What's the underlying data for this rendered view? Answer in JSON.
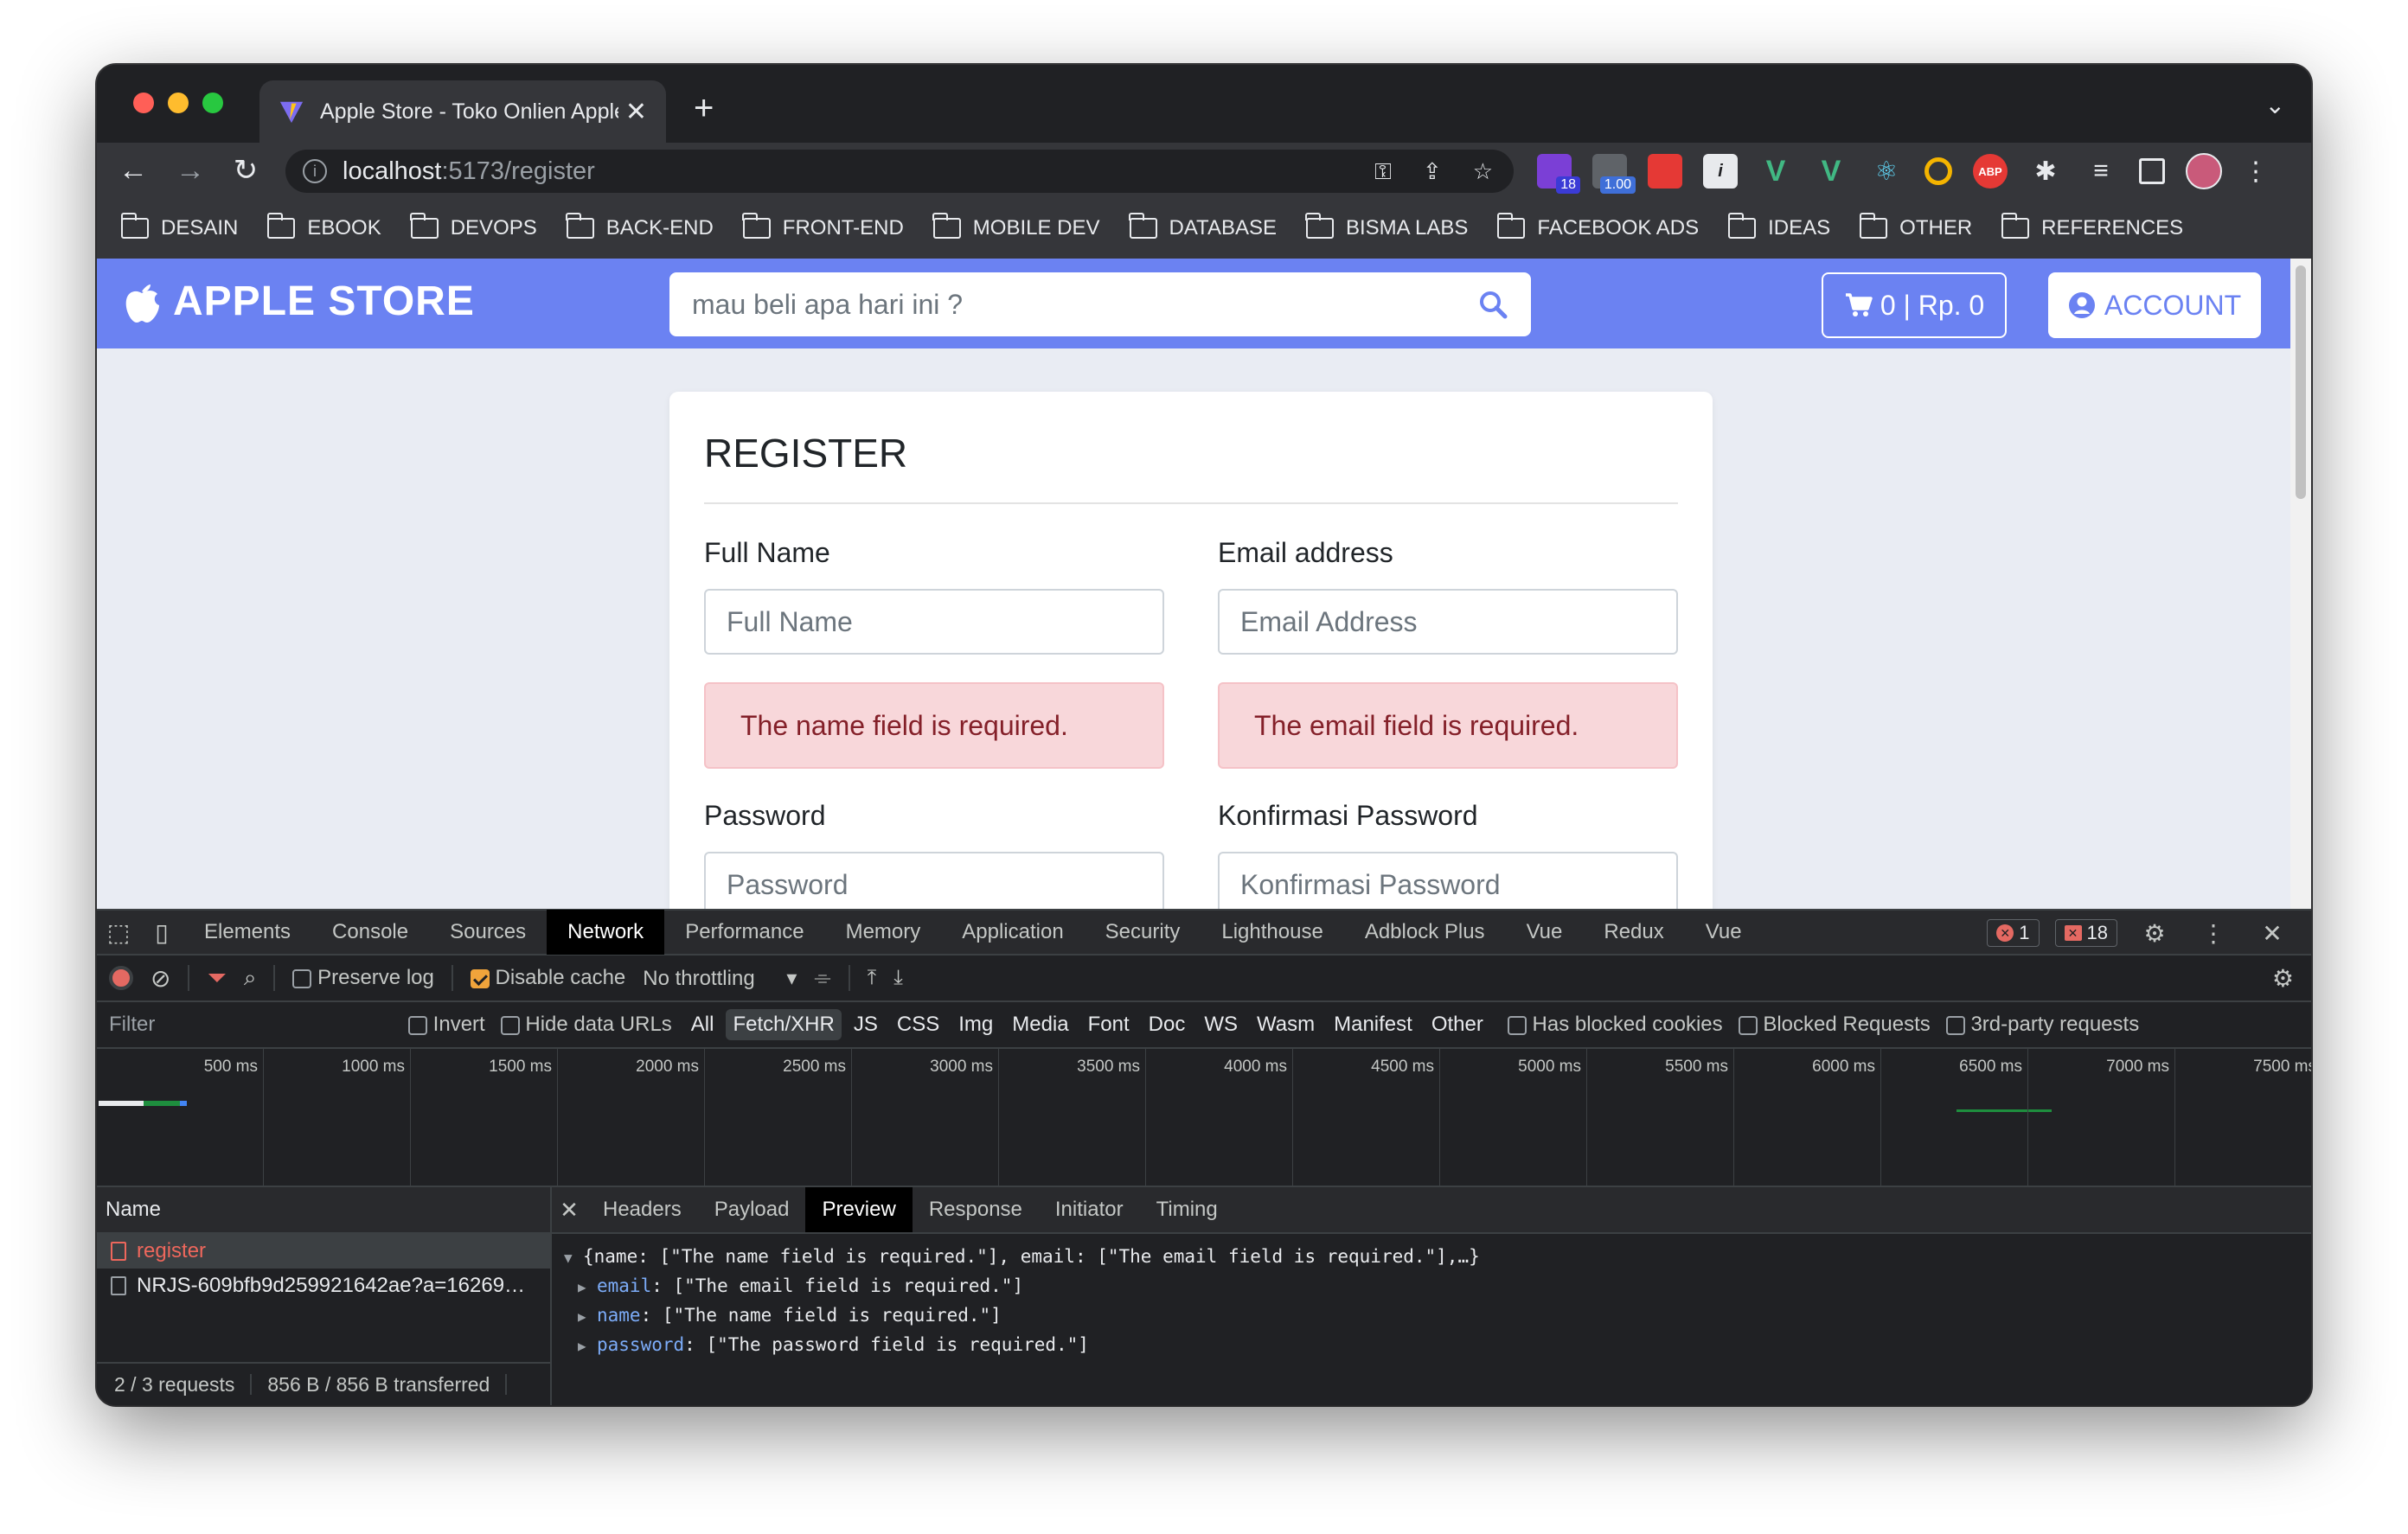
{
  "browser": {
    "tab_title": "Apple Store - Toko Onlien Apple",
    "tab_close": "✕",
    "new_tab": "+",
    "url_host": "localhost",
    "url_path": ":5173/register",
    "extensions": [
      {
        "name": "ext-purple",
        "color": "#7b3fd6",
        "badge": "18",
        "badge_color": "#3b3bd6"
      },
      {
        "name": "ext-robot",
        "color": "#5f6368",
        "badge": "1.00",
        "badge_color": "#3f6fd8"
      },
      {
        "name": "ext-red-square",
        "color": "#e53935",
        "badge": "",
        "badge_color": ""
      },
      {
        "name": "ext-info",
        "color": "#e8eaed",
        "badge": "",
        "badge_color": ""
      },
      {
        "name": "ext-vue-1",
        "color": "#41b883",
        "badge": "",
        "badge_color": ""
      },
      {
        "name": "ext-vue-2",
        "color": "#41b883",
        "badge": "",
        "badge_color": ""
      },
      {
        "name": "ext-react",
        "color": "#61dafb",
        "badge": "",
        "badge_color": ""
      },
      {
        "name": "ext-color-ring",
        "color": "#f4b400",
        "badge": "",
        "badge_color": ""
      },
      {
        "name": "ext-abp",
        "color": "#e53935",
        "badge": "",
        "badge_color": ""
      }
    ],
    "abp_label": "ABP",
    "bookmarks": [
      "DESAIN",
      "EBOOK",
      "DEVOPS",
      "BACK-END",
      "FRONT-END",
      "MOBILE DEV",
      "DATABASE",
      "BISMA LABS",
      "FACEBOOK ADS",
      "IDEAS",
      "OTHER",
      "REFERENCES"
    ]
  },
  "site": {
    "brand": "APPLE STORE",
    "search_placeholder": "mau beli apa hari ini ?",
    "cart_label": "0 | Rp. 0",
    "account_label": "ACCOUNT",
    "accent": "#6b82f2"
  },
  "form": {
    "title": "REGISTER",
    "full_name_label": "Full Name",
    "full_name_placeholder": "Full Name",
    "email_label": "Email address",
    "email_placeholder": "Email Address",
    "name_error": "The name field is required.",
    "email_error": "The email field is required.",
    "password_label": "Password",
    "password_placeholder": "Password",
    "confirm_label": "Konfirmasi Password",
    "confirm_placeholder": "Konfirmasi Password"
  },
  "devtools": {
    "tabs": [
      "Elements",
      "Console",
      "Sources",
      "Network",
      "Performance",
      "Memory",
      "Application",
      "Security",
      "Lighthouse",
      "Adblock Plus",
      "Vue",
      "Redux",
      "Vue"
    ],
    "active_tab": "Network",
    "error_count": "1",
    "issue_count": "18",
    "preserve_log": "Preserve log",
    "disable_cache": "Disable cache",
    "throttling": "No throttling",
    "filter_placeholder": "Filter",
    "invert": "Invert",
    "hide_data_urls": "Hide data URLs",
    "types": [
      "All",
      "Fetch/XHR",
      "JS",
      "CSS",
      "Img",
      "Media",
      "Font",
      "Doc",
      "WS",
      "Wasm",
      "Manifest",
      "Other"
    ],
    "active_type": "Fetch/XHR",
    "has_blocked_cookies": "Has blocked cookies",
    "blocked_requests": "Blocked Requests",
    "third_party": "3rd-party requests",
    "timeline_labels": [
      "500 ms",
      "1000 ms",
      "1500 ms",
      "2000 ms",
      "2500 ms",
      "3000 ms",
      "3500 ms",
      "4000 ms",
      "4500 ms",
      "5000 ms",
      "5500 ms",
      "6000 ms",
      "6500 ms",
      "7000 ms",
      "7500 ms"
    ],
    "name_header": "Name",
    "requests": [
      {
        "name": "register",
        "selected": true
      },
      {
        "name": "NRJS-609bfb9d259921642ae?a=16269…",
        "selected": false
      }
    ],
    "footer_requests": "2 / 3 requests",
    "footer_transferred": "856 B / 856 B transferred",
    "detail_tabs": [
      "Headers",
      "Payload",
      "Preview",
      "Response",
      "Initiator",
      "Timing"
    ],
    "active_detail_tab": "Preview",
    "preview_summary": "{name: [\"The name field is required.\"], email: [\"The email field is required.\"],…}",
    "preview_rows": [
      {
        "key": "email",
        "value": ": [\"The email field is required.\"]"
      },
      {
        "key": "name",
        "value": ": [\"The name field is required.\"]"
      },
      {
        "key": "password",
        "value": ": [\"The password field is required.\"]"
      }
    ]
  }
}
